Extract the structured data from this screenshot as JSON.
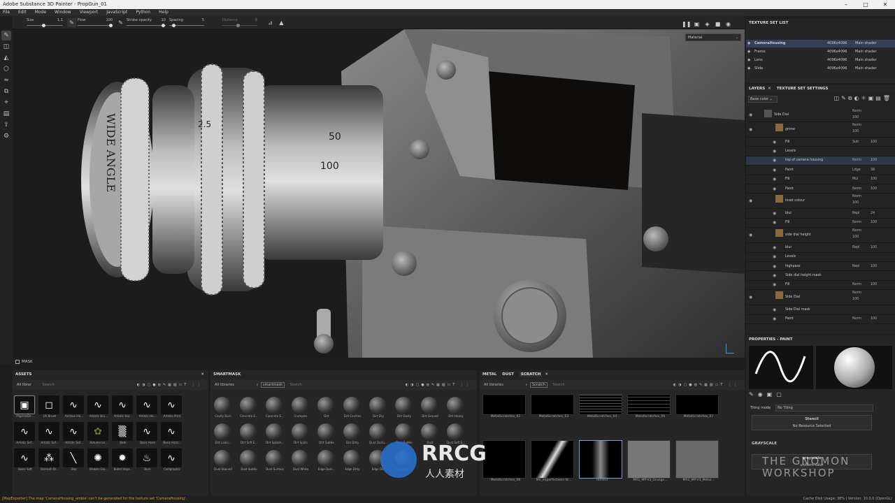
{
  "window": {
    "title": "Adobe Substance 3D Painter - PropGun_01"
  },
  "menu": [
    "File",
    "Edit",
    "Mode",
    "Window",
    "Viewport",
    "JavaScript",
    "Python",
    "Help"
  ],
  "toolbar": {
    "size_label": "Size",
    "size_value": "1.1",
    "flow_label": "Flow",
    "flow_value": "100",
    "opacity_label": "Stroke opacity",
    "opacity_value": "10",
    "spacing_label": "Spacing",
    "spacing_value": "5",
    "distance_label": "Distance",
    "distance_value": "8"
  },
  "viewport": {
    "mode": "Material",
    "mask_label": "MASK"
  },
  "texture_set_list": {
    "title": "TEXTURE SET LIST",
    "sets": [
      {
        "name": "CameraHousing",
        "res": "4096x4096",
        "shader": "Main shader"
      },
      {
        "name": "Frame",
        "res": "4096x4096",
        "shader": "Main shader"
      },
      {
        "name": "Lens",
        "res": "4096x4096",
        "shader": "Main shader"
      },
      {
        "name": "Slide",
        "res": "4096x4096",
        "shader": "Main shader"
      }
    ]
  },
  "layers": {
    "tab1": "LAYERS",
    "tab2": "TEXTURE SET SETTINGS",
    "channel": "Base color",
    "rows": [
      {
        "name": "Side Dial",
        "blend": "Norm",
        "opacity": "100",
        "indent": 0,
        "type": "folder"
      },
      {
        "name": "grime",
        "blend": "Norm",
        "opacity": "100",
        "indent": 1,
        "type": "layer"
      },
      {
        "name": "Fill",
        "blend": "Sub",
        "opacity": "100",
        "indent": 2,
        "type": "effect"
      },
      {
        "name": "Levels",
        "blend": "",
        "opacity": "",
        "indent": 2,
        "type": "effect"
      },
      {
        "name": "top of camera housing",
        "blend": "Norm",
        "opacity": "100",
        "indent": 2,
        "type": "effect"
      },
      {
        "name": "Paint",
        "blend": "Ldge",
        "opacity": "38",
        "indent": 2,
        "type": "effect"
      },
      {
        "name": "Fill",
        "blend": "Mul",
        "opacity": "100",
        "indent": 2,
        "type": "effect"
      },
      {
        "name": "Paint",
        "blend": "Norm",
        "opacity": "100",
        "indent": 2,
        "type": "effect"
      },
      {
        "name": "Inset colour",
        "blend": "Norm",
        "opacity": "100",
        "indent": 1,
        "type": "layer"
      },
      {
        "name": "blur",
        "blend": "Repl",
        "opacity": "24",
        "indent": 2,
        "type": "effect"
      },
      {
        "name": "Fill",
        "blend": "Norm",
        "opacity": "100",
        "indent": 2,
        "type": "effect"
      },
      {
        "name": "side dial height",
        "blend": "Norm",
        "opacity": "100",
        "indent": 1,
        "type": "layer"
      },
      {
        "name": "blur",
        "blend": "Repl",
        "opacity": "100",
        "indent": 2,
        "type": "effect"
      },
      {
        "name": "Levels",
        "blend": "",
        "opacity": "",
        "indent": 2,
        "type": "effect"
      },
      {
        "name": "highpass",
        "blend": "Repl",
        "opacity": "100",
        "indent": 2,
        "type": "effect"
      },
      {
        "name": "Side dial height mask",
        "blend": "",
        "opacity": "",
        "indent": 2,
        "type": "effect"
      },
      {
        "name": "Fill",
        "blend": "Norm",
        "opacity": "100",
        "indent": 2,
        "type": "effect"
      },
      {
        "name": "Side Dial",
        "blend": "Norm",
        "opacity": "100",
        "indent": 1,
        "type": "layer"
      },
      {
        "name": "Side Dial mask",
        "blend": "",
        "opacity": "",
        "indent": 2,
        "type": "effect"
      },
      {
        "name": "Paint",
        "blend": "Norm",
        "opacity": "100",
        "indent": 2,
        "type": "effect"
      }
    ]
  },
  "properties": {
    "title": "PROPERTIES - PAINT",
    "tiling_label": "Tiling mode",
    "tiling_value": "No Tiling",
    "stencil_label": "Stencil",
    "stencil_value": "No Resource Selected",
    "grayscale_title": "GRAYSCALE",
    "grayscale_label": "grayscale",
    "grayscale_value": "uniform color"
  },
  "assets": {
    "title": "ASSETS",
    "library": "All librar",
    "search": "Search",
    "items": [
      "PilgrimsDe...",
      "UV Brush",
      "Archive Ink...",
      "Artistic Bru...",
      "Artistic Hai...",
      "Artistic He...",
      "Artistic Print",
      "Artistic Sof...",
      "Artistic Sof...",
      "Artistic Sof...",
      "Autumn Le...",
      "Bark",
      "Basic Hard",
      "Basic Hard...",
      "Basic Soft",
      "Bismuth Br...",
      "Blur",
      "Broken Gla...",
      "Bullet Impa...",
      "Burn",
      "Calligraphic"
    ]
  },
  "smartmask": {
    "title": "SMARTMASK",
    "library": "All libraries",
    "filter": "smartmask",
    "search": "Search",
    "items": [
      "Cavity Burn",
      "Concrete E...",
      "Concrete E...",
      "Crumples",
      "Dirt",
      "Dirt Cavities",
      "Dirt Dry",
      "Dirt Dusty",
      "Dirt Ground",
      "Dirt Heavy",
      "Dirt Leaki...",
      "Dirt Soft E...",
      "Dirt Splash...",
      "Dirt Spots",
      "Dirt Subtle",
      "Dirt Dirty",
      "Dust Occlu...",
      "Dust Subtle",
      "Dust",
      "Dust Soft E...",
      "Dust Stained",
      "Dust Subtle",
      "Dust Surface",
      "Dust White",
      "Edge Dam...",
      "Edge Dirty",
      "Edge Dirt",
      "Edge Dam..."
    ]
  },
  "scratch": {
    "tabs": [
      "METAL",
      "DUST",
      "SCRATCH"
    ],
    "library": "All libraries",
    "filter": "Scratch",
    "search": "Search",
    "items": [
      "MetalScratches_02",
      "MetalScratches_03",
      "MetalScratches_04",
      "MetalScratches_06",
      "MetalScratches_07",
      "MetalScratches_08",
      "MX_Imperfections-St...",
      "mmm3",
      "MR2_MP-V3_Grunge...",
      "MR2_MP-V3_Metal..."
    ]
  },
  "status": {
    "message": "[MapExporter] The map 'CameraHousing_ambie' can't be generated for the texture set 'CameraHousing'.",
    "right": "Cache Disk Usage: 38% | Version: 10.0.0 (OpenGL)"
  },
  "watermark": {
    "left": "RRCG",
    "left_sub": "人人素材",
    "right": "THE GNOMON WORKSHOP"
  }
}
